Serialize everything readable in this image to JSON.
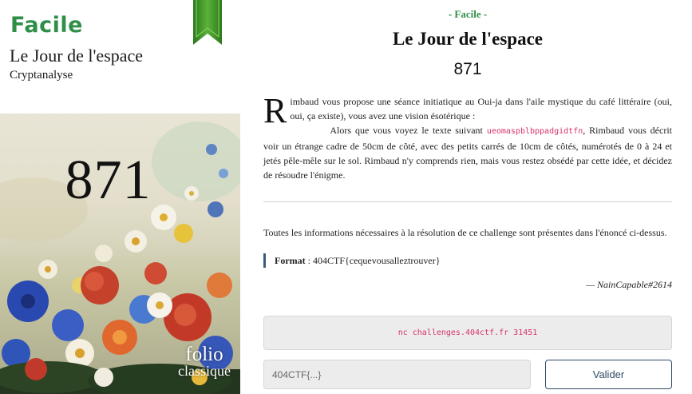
{
  "cover": {
    "difficulty": "Facile",
    "title": "Le Jour de l'espace",
    "category": "Cryptanalyse",
    "number": "871",
    "brand_line1": "folio",
    "brand_line2": "classique",
    "colors": {
      "difficulty": "#2f8f48",
      "ribbon": "#3f9a2a"
    }
  },
  "challenge": {
    "difficulty": "- Facile -",
    "title": "Le Jour de l'espace",
    "number": "871",
    "story": {
      "dropcap": "R",
      "p1": "imbaud vous propose une séance initiatique au Oui-ja dans l'aile mystique du café littéraire (oui, oui, ça existe), vous avez une vision ésotérique :",
      "p2_before": "Alors que vous voyez le texte suivant ",
      "cipher": "ueomaspblbppadgidtfn",
      "p2_after": ", Rimbaud vous décrit voir un étrange cadre de 50cm de côté, avec des petits carrés de 10cm de côtés, numérotés de 0 à 24 et jetés pêle-mêle sur le sol. Rimbaud n'y comprends rien, mais vous restez obsédé par cette idée, et décidez de résoudre l'énigme."
    },
    "info": "Toutes les informations nécessaires à la résolution de ce challenge sont présentes dans l'énoncé ci-dessus.",
    "format_label": "Format",
    "format_sep": " : ",
    "format_value": "404CTF{cequevousalleztrouver}",
    "author": "— NainCapable#2614",
    "connection": "nc challenges.404ctf.fr 31451"
  },
  "form": {
    "flag_placeholder": "404CTF{...}",
    "submit_label": "Valider"
  },
  "colors": {
    "accent": "#2f8f48",
    "code": "#d6336c",
    "button": "#2f4a66",
    "format_bar": "#3b5a78"
  }
}
